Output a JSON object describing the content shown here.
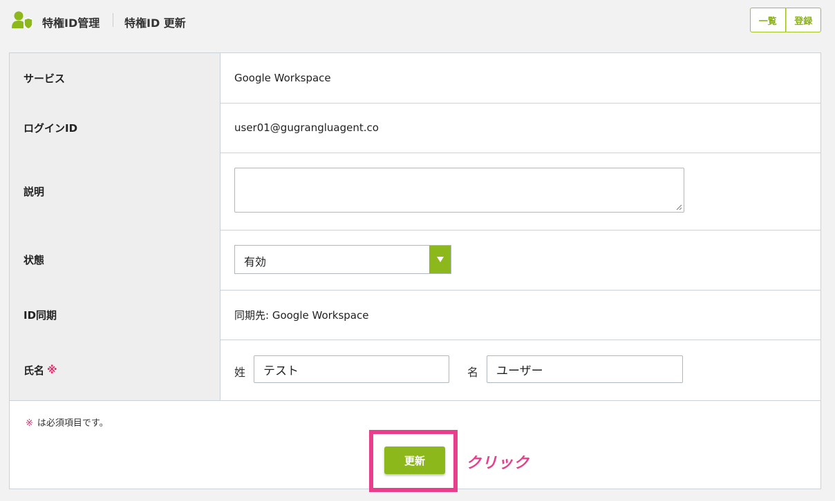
{
  "header": {
    "crumb_section": "特権ID管理",
    "crumb_page": "特権ID 更新",
    "list_button": "一覧",
    "register_button": "登録"
  },
  "form": {
    "rows": [
      {
        "label": "サービス",
        "value": "Google Workspace"
      },
      {
        "label": "ログインID",
        "value": "user01@gugrangluagent.co"
      },
      {
        "label": "説明",
        "value": ""
      },
      {
        "label": "状態",
        "value": "有効"
      },
      {
        "label": "ID同期",
        "value": "同期先: Google Workspace"
      },
      {
        "label": "氏名",
        "required_mark": "※"
      }
    ],
    "name": {
      "last_label": "姓",
      "last_value": "テスト",
      "first_label": "名",
      "first_value": "ユーザー"
    },
    "note_mark": "※",
    "note_text": "は必須項目です。",
    "update_button": "更新"
  },
  "annotation": {
    "click_text": "クリック"
  },
  "colors": {
    "accent": "#8db81c",
    "highlight": "#e83e8c",
    "label_bg": "#eeeeee"
  }
}
